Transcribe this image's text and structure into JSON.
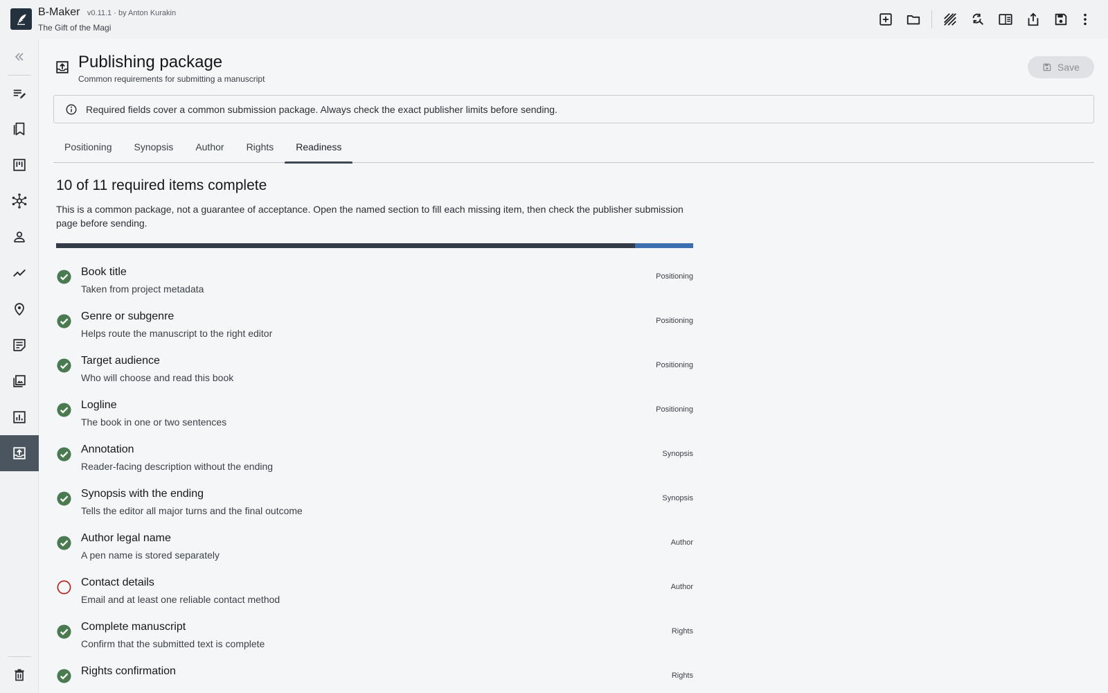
{
  "app": {
    "name": "B-Maker",
    "version": "v0.11.1 · by Anton Kurakin",
    "project": "The Gift of the Magi"
  },
  "toolbar": {
    "icons": [
      "add-box-icon",
      "folder-icon",
      "texture-icon",
      "find-replace-icon",
      "split-view-icon",
      "share-icon",
      "save-icon",
      "more-vert-icon"
    ]
  },
  "sidebar": {
    "items": [
      {
        "id": "collapse",
        "icon": "double-chevron-left-icon"
      },
      {
        "id": "editor",
        "icon": "edit-note-icon"
      },
      {
        "id": "chapters",
        "icon": "bookmarks-icon"
      },
      {
        "id": "board",
        "icon": "kanban-icon"
      },
      {
        "id": "graph",
        "icon": "hub-icon"
      },
      {
        "id": "characters",
        "icon": "person-icon"
      },
      {
        "id": "timeline",
        "icon": "trend-icon"
      },
      {
        "id": "locations",
        "icon": "place-icon"
      },
      {
        "id": "notes",
        "icon": "sticky-note-icon"
      },
      {
        "id": "gallery",
        "icon": "photo-library-icon"
      },
      {
        "id": "statistics",
        "icon": "stats-icon"
      },
      {
        "id": "publishing",
        "icon": "publish-icon",
        "active": true
      },
      {
        "id": "trash",
        "icon": "delete-icon"
      }
    ]
  },
  "header": {
    "title": "Publishing package",
    "subtitle": "Common requirements for submitting a manuscript",
    "save_label": "Save"
  },
  "info": {
    "text": "Required fields cover a common submission package. Always check the exact publisher limits before sending."
  },
  "tabs": [
    {
      "label": "Positioning"
    },
    {
      "label": "Synopsis"
    },
    {
      "label": "Author"
    },
    {
      "label": "Rights"
    },
    {
      "label": "Readiness",
      "active": true
    }
  ],
  "readiness": {
    "title": "10 of 11 required items complete",
    "description": "This is a common package, not a guarantee of acceptance. Open the named section to fill each missing item, then check the publisher submission page before sending.",
    "completed": 10,
    "total": 11
  },
  "checklist": [
    {
      "title": "Book title",
      "desc": "Taken from project metadata",
      "section": "Positioning",
      "done": true
    },
    {
      "title": "Genre or subgenre",
      "desc": "Helps route the manuscript to the right editor",
      "section": "Positioning",
      "done": true
    },
    {
      "title": "Target audience",
      "desc": "Who will choose and read this book",
      "section": "Positioning",
      "done": true
    },
    {
      "title": "Logline",
      "desc": "The book in one or two sentences",
      "section": "Positioning",
      "done": true
    },
    {
      "title": "Annotation",
      "desc": "Reader-facing description without the ending",
      "section": "Synopsis",
      "done": true
    },
    {
      "title": "Synopsis with the ending",
      "desc": "Tells the editor all major turns and the final outcome",
      "section": "Synopsis",
      "done": true
    },
    {
      "title": "Author legal name",
      "desc": "A pen name is stored separately",
      "section": "Author",
      "done": true
    },
    {
      "title": "Contact details",
      "desc": "Email and at least one reliable contact method",
      "section": "Author",
      "done": false
    },
    {
      "title": "Complete manuscript",
      "desc": "Confirm that the submitted text is complete",
      "section": "Rights",
      "done": true
    },
    {
      "title": "Rights confirmation",
      "desc": "",
      "section": "Rights",
      "done": true
    }
  ],
  "colors": {
    "done": "#4a7a4f",
    "missing": "#b3261e",
    "progress_fill": "#333b46",
    "progress_track": "#3b6fb0",
    "active_nav": "#4b5560"
  }
}
